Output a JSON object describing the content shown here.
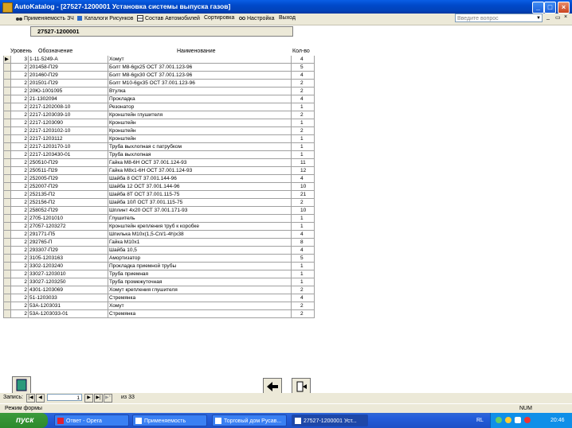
{
  "window": {
    "title": "AutoKatalog - [27527-1200001  Установка системы выпуска газов]"
  },
  "menu": [
    {
      "label": "Применяемость ЗЧ",
      "icon": "binoculars-icon"
    },
    {
      "label": "Каталоги Рисунков",
      "icon": "book-icon"
    },
    {
      "label": "Состав Автомобилей",
      "icon": "grid-icon"
    },
    {
      "label": "Сортировка",
      "icon": ""
    },
    {
      "label": "Настройка",
      "icon": "glasses-icon"
    },
    {
      "label": "Выход",
      "icon": ""
    }
  ],
  "help": {
    "placeholder": "Введите вопрос"
  },
  "form": {
    "header_value": "27527-1200001",
    "columns": {
      "level": "Уровень",
      "code": "Обозначение",
      "name": "Наименование",
      "qty": "Кол-во"
    }
  },
  "rows": [
    {
      "level": "3",
      "code": "1-11-5249-А",
      "name": "Хомут",
      "qty": "4"
    },
    {
      "level": "2",
      "code": "201458-П29",
      "name": "Болт М8-6gх25 ОСТ 37.001.123-96",
      "qty": "5"
    },
    {
      "level": "2",
      "code": "201460-П29",
      "name": "Болт М8-6gх30 ОСТ 37.001.123-96",
      "qty": "4"
    },
    {
      "level": "2",
      "code": "201501-П29",
      "name": "Болт М10-6gх35 ОСТ 37.001.123-96",
      "qty": "2"
    },
    {
      "level": "2",
      "code": "20Ю-1001095",
      "name": "Втулка",
      "qty": "2"
    },
    {
      "level": "2",
      "code": "21-1302094",
      "name": "Прокладка",
      "qty": "4"
    },
    {
      "level": "2",
      "code": "2217-1202008-10",
      "name": "Резонатор",
      "qty": "1"
    },
    {
      "level": "2",
      "code": "2217-1203039-10",
      "name": "Кронштейн глушителя",
      "qty": "2"
    },
    {
      "level": "2",
      "code": "2217-1203090",
      "name": "Кронштейн",
      "qty": "1"
    },
    {
      "level": "2",
      "code": "2217-1203102-10",
      "name": "Кронштейн",
      "qty": "2"
    },
    {
      "level": "2",
      "code": "2217-1203112",
      "name": "Кронштейн",
      "qty": "1"
    },
    {
      "level": "2",
      "code": "2217-1203170-10",
      "name": "Труба выхлопная с патрубком",
      "qty": "1"
    },
    {
      "level": "2",
      "code": "2217-1203430-01",
      "name": "Труба выхлопная",
      "qty": "1"
    },
    {
      "level": "2",
      "code": "250510-П29",
      "name": "Гайка М8-6Н ОСТ 37.001.124-93",
      "qty": "11"
    },
    {
      "level": "2",
      "code": "250511-П29",
      "name": "Гайка М8х1-6Н ОСТ 37.001.124-93",
      "qty": "12"
    },
    {
      "level": "2",
      "code": "252005-П29",
      "name": "Шайба 8 ОСТ 37.001.144-96",
      "qty": "4"
    },
    {
      "level": "2",
      "code": "252007-П29",
      "name": "Шайба 12 ОСТ 37.001.144-96",
      "qty": "10"
    },
    {
      "level": "2",
      "code": "252135-П2",
      "name": "Шайба 8Т ОСТ 37.001.115-75",
      "qty": "21"
    },
    {
      "level": "2",
      "code": "252156-П2",
      "name": "Шайба 10Л ОСТ 37.001.115-75",
      "qty": "2"
    },
    {
      "level": "2",
      "code": "258052-П29",
      "name": "Шплинт 4х20 ОСТ 37.001.171-93",
      "qty": "10"
    },
    {
      "level": "2",
      "code": "2705-1201010",
      "name": "Глушитель",
      "qty": "1"
    },
    {
      "level": "2",
      "code": "27057-1203272",
      "name": "Кронштейн крепления труб к коробке",
      "qty": "1"
    },
    {
      "level": "2",
      "code": "291771-П5",
      "name": "Шпилька М10х(1,5-Сп/1-4h)х38",
      "qty": "4"
    },
    {
      "level": "2",
      "code": "292765-П",
      "name": "Гайка М10х1",
      "qty": "8"
    },
    {
      "level": "2",
      "code": "293307-П29",
      "name": "Шайба 10,5",
      "qty": "4"
    },
    {
      "level": "2",
      "code": "3105-1203163",
      "name": "Амортизатор",
      "qty": "5"
    },
    {
      "level": "2",
      "code": "3302-1203240",
      "name": "Прокладка приемной трубы",
      "qty": "1"
    },
    {
      "level": "2",
      "code": "33027-1203010",
      "name": "Труба приемная",
      "qty": "1"
    },
    {
      "level": "2",
      "code": "33027-1203250",
      "name": "Труба промежуточная",
      "qty": "1"
    },
    {
      "level": "2",
      "code": "4301-1203069",
      "name": "Хомут крепления глушителя",
      "qty": "2"
    },
    {
      "level": "2",
      "code": "51-1203033",
      "name": "Стремянка",
      "qty": "4"
    },
    {
      "level": "2",
      "code": "53А-1203031",
      "name": "Хомут",
      "qty": "2"
    },
    {
      "level": "2",
      "code": "53А-1203033-01",
      "name": "Стремянка",
      "qty": "2"
    }
  ],
  "navigation": {
    "label": "Запись:",
    "current": "1",
    "total_text": "из  33"
  },
  "status": {
    "left": "Режим формы",
    "right": "NUM"
  },
  "taskbar": {
    "start": "пуск",
    "tasks": [
      {
        "label": "Ответ - Opera"
      },
      {
        "label": "Применяемость"
      },
      {
        "label": "Торговый дом Русав..."
      },
      {
        "label": "27527-1200001  Уст..."
      }
    ],
    "lang": "RL",
    "clock": "20:46"
  }
}
